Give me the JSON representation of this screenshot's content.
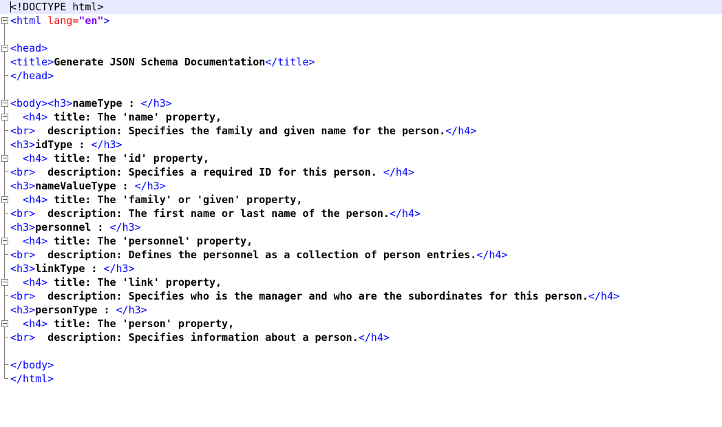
{
  "editor": {
    "lines": {
      "doctype": "<!DOCTYPE html>",
      "html_open_tag": "<html",
      "html_lang_attr": " lang=",
      "html_lang_value": "\"en\"",
      "html_open_close": ">",
      "head_open": "<head>",
      "title_open": "<title>",
      "title_text": "Generate JSON Schema Documentation",
      "title_close": "</title>",
      "head_close": "</head>",
      "body_open": "<body><h3>",
      "sections": [
        {
          "h3_name": "nameType",
          "h3_sep": " : ",
          "h4_title": " title: The 'name' property,",
          "h4_desc": "  description: Specifies the family and given name for the person."
        },
        {
          "h3_name": "idType",
          "h3_sep": " : ",
          "h4_title": " title: The 'id' property,",
          "h4_desc": "  description: Specifies a required ID for this person. "
        },
        {
          "h3_name": "nameValueType",
          "h3_sep": " : ",
          "h4_title": " title: The 'family' or 'given' property,",
          "h4_desc": "  description: The first name or last name of the person."
        },
        {
          "h3_name": "personnel",
          "h3_sep": " : ",
          "h4_title": " title: The 'personnel' property,",
          "h4_desc": "  description: Defines the personnel as a collection of person entries."
        },
        {
          "h3_name": "linkType",
          "h3_sep": " : ",
          "h4_title": " title: The 'link' property,",
          "h4_desc": "  description: Specifies who is the manager and who are the subordinates for this person."
        },
        {
          "h3_name": "personType",
          "h3_sep": " : ",
          "h4_title": " title: The 'person' property,",
          "h4_desc": "  description: Specifies information about a person."
        }
      ],
      "h3_open": "<h3>",
      "h3_close": "</h3>",
      "h4_open": "  <h4>",
      "h4_close": "</h4>",
      "br": "<br>",
      "body_close": "</body>",
      "html_close": "</html>"
    }
  }
}
